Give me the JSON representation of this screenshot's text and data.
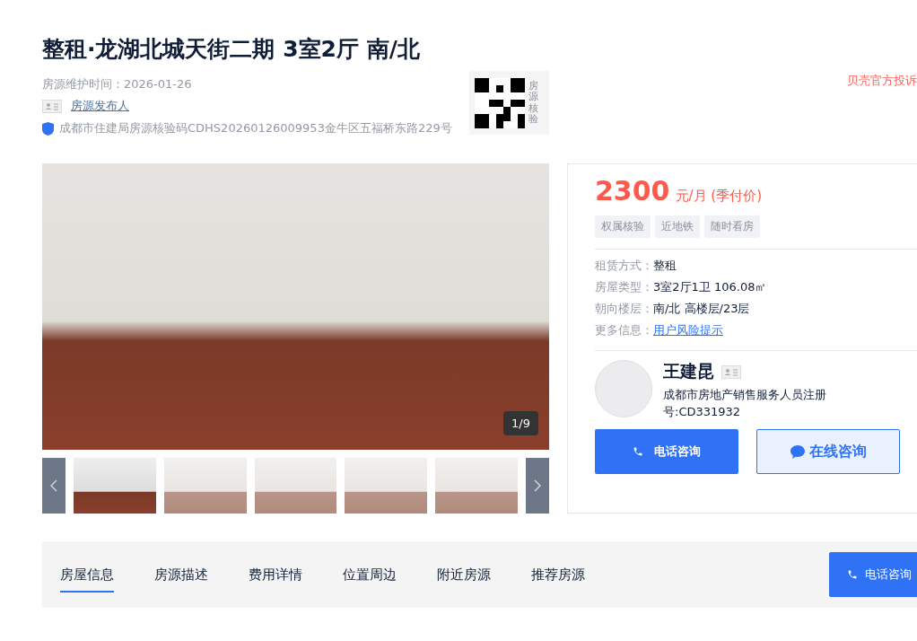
{
  "title": "整租·龙湖北城天街二期 3室2厅 南/北",
  "maintained": "房源维护时间：2026-01-26",
  "publisher_link": "房源发布人",
  "verification": "成都市住建局房源核验码CDHS20260126009953金牛区五福桥东路229号",
  "qr_label": "房源核验",
  "complaint_link": "贝壳官方投诉",
  "gallery": {
    "counter": "1/9",
    "thumbnails": [
      {
        "selected": true
      },
      {
        "selected": false
      },
      {
        "selected": false
      },
      {
        "selected": false
      },
      {
        "selected": false
      }
    ]
  },
  "price": {
    "amount": "2300",
    "unit": "元/月 (季付价)"
  },
  "tags": [
    "权属核验",
    "近地铁",
    "随时看房"
  ],
  "details": [
    {
      "label": "租赁方式：",
      "value": "整租",
      "kind": "text"
    },
    {
      "label": "房屋类型：",
      "value": "3室2厅1卫 106.08㎡",
      "kind": "text"
    },
    {
      "label": "朝向楼层：",
      "value": "南/北 高楼层/23层",
      "kind": "text"
    },
    {
      "label": "更多信息：",
      "value": "用户风险提示",
      "kind": "link"
    }
  ],
  "agent": {
    "name": "王建昆",
    "registration": "成都市房地产销售服务人员注册号:CD331932"
  },
  "buttons": {
    "phone": "电话咨询",
    "online": "在线咨询"
  },
  "tabs": [
    {
      "label": "房屋信息",
      "selected": true
    },
    {
      "label": "房源描述",
      "selected": false
    },
    {
      "label": "费用详情",
      "selected": false
    },
    {
      "label": "位置周边",
      "selected": false
    },
    {
      "label": "附近房源",
      "selected": false
    },
    {
      "label": "推荐房源",
      "selected": false
    }
  ],
  "nav_button": "电话咨询"
}
